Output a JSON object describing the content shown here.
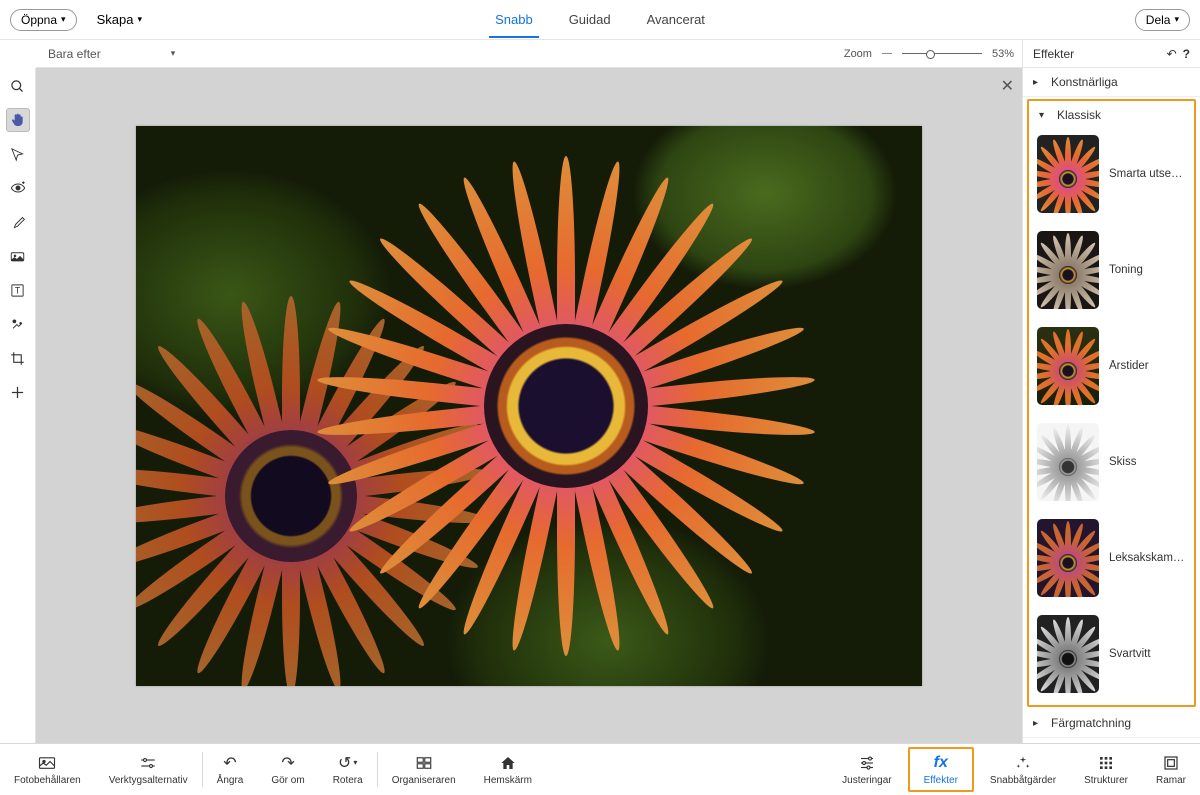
{
  "topbar": {
    "open": "Öppna",
    "create": "Skapa",
    "share": "Dela"
  },
  "tabs": {
    "quick": "Snabb",
    "guided": "Guidad",
    "advanced": "Avancerat"
  },
  "secbar": {
    "view": "Bara efter",
    "zoom_label": "Zoom",
    "zoom_value": "53%",
    "effects": "Effekter"
  },
  "effects_panel": {
    "artistic": "Konstnärliga",
    "classic": "Klassisk",
    "color_match": "Färgmatchning",
    "items": {
      "smart": "Smarta utseen…",
      "toning": "Toning",
      "seasons": "Årstider",
      "sketch": "Skiss",
      "toy": "Leksakskamera",
      "bw": "Svartvitt"
    }
  },
  "tools": {
    "zoom": "zoom",
    "hand": "hand",
    "select": "select",
    "eye": "eye",
    "brush": "brush",
    "stamp": "stamp",
    "text": "text",
    "heal": "heal",
    "crop": "crop",
    "add": "dial"
  },
  "bottombar": {
    "photo_bin": "Fotobehållaren",
    "tool_options": "Verktygsalternativ",
    "undo": "Ångra",
    "redo": "Gör om",
    "rotate": "Rotera",
    "organizer": "Organiseraren",
    "home": "Hemskärm",
    "adjustments": "Justeringar",
    "effects": "Effekter",
    "quick_actions": "Snabbåtgärder",
    "textures": "Strukturer",
    "frames": "Ramar"
  }
}
